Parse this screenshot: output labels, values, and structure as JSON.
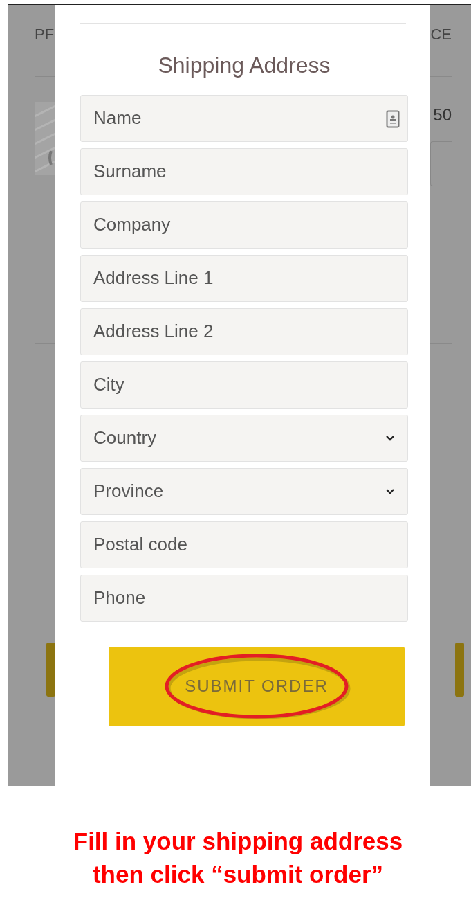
{
  "background_page": {
    "header_left": "PF",
    "header_right": "CE",
    "price": "50"
  },
  "modal": {
    "title": "Shipping Address",
    "fields": [
      {
        "placeholder": "Name",
        "kind": "contact"
      },
      {
        "placeholder": "Surname",
        "kind": "text"
      },
      {
        "placeholder": "Company",
        "kind": "text"
      },
      {
        "placeholder": "Address Line 1",
        "kind": "text"
      },
      {
        "placeholder": "Address Line 2",
        "kind": "text"
      },
      {
        "placeholder": "City",
        "kind": "text"
      },
      {
        "placeholder": "Country",
        "kind": "select"
      },
      {
        "placeholder": "Province",
        "kind": "select"
      },
      {
        "placeholder": "Postal code",
        "kind": "text"
      },
      {
        "placeholder": "Phone",
        "kind": "text"
      }
    ],
    "submit_button": "SUBMIT ORDER"
  },
  "caption": [
    "Fill in your shipping address",
    "then click “submit order”"
  ]
}
